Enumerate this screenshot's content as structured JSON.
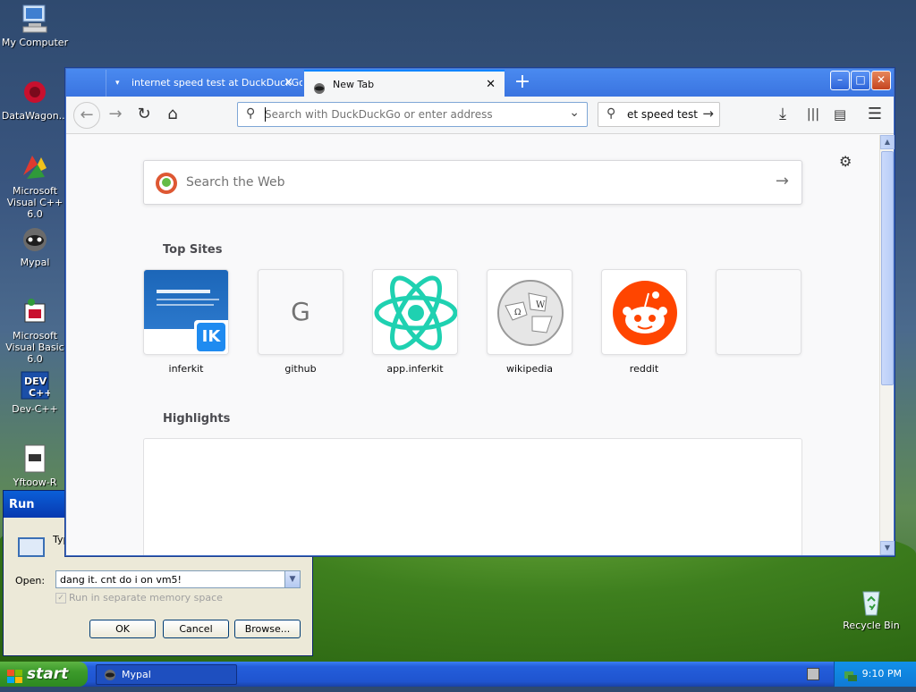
{
  "desktop": {
    "icons": [
      {
        "label": "My Computer"
      },
      {
        "label": "DataWagon..."
      },
      {
        "label": "Microsoft Visual C++ 6.0"
      },
      {
        "label": "Mypal"
      },
      {
        "label": "Microsoft Visual Basic 6.0"
      },
      {
        "label": "Dev-C++"
      },
      {
        "label": "Yftoow-R"
      },
      {
        "label": "Recycle Bin"
      }
    ]
  },
  "browser": {
    "tabs": [
      {
        "label": "internet speed test at DuckDuckGo"
      },
      {
        "label": "New Tab"
      }
    ],
    "url_placeholder": "Search with DuckDuckGo or enter address",
    "search_value": "et speed test",
    "newtab": {
      "search_placeholder": "Search the Web",
      "top_sites_heading": "Top Sites",
      "highlights_heading": "Highlights",
      "sites": [
        {
          "label": "inferkit",
          "badge": "IK"
        },
        {
          "label": "github",
          "letter": "G"
        },
        {
          "label": "app.inferkit"
        },
        {
          "label": "wikipedia"
        },
        {
          "label": "reddit"
        }
      ]
    }
  },
  "run_dialog": {
    "title": "Run",
    "text": "Type the name of a program, folder, document, or Internet resource",
    "open_label": "Open:",
    "open_value": "dang it. cnt do i on vm5!",
    "checkbox_label": "Run in separate memory space",
    "ok": "OK",
    "cancel": "Cancel",
    "browse": "Browse..."
  },
  "taskbar": {
    "start_label": "start",
    "task_label": "Mypal",
    "clock": "9:10 PM"
  }
}
